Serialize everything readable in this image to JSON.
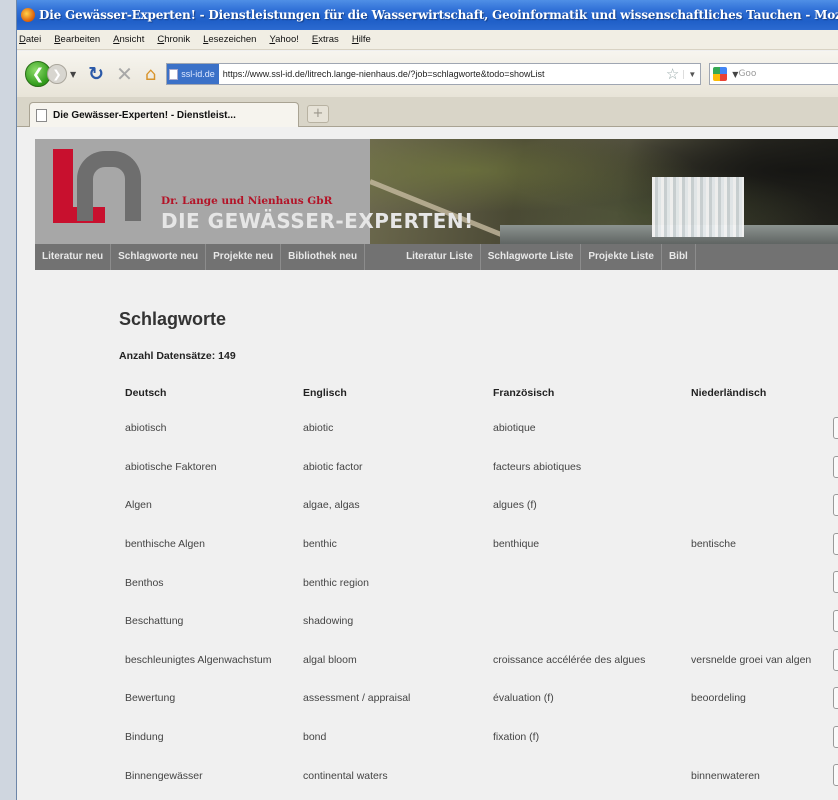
{
  "window": {
    "title": "Die Gewässer-Experten! - Dienstleistungen für die Wasserwirtschaft, Geoinformatik und wissenschaftliches Tauchen - Moz"
  },
  "menu": [
    "Datei",
    "Bearbeiten",
    "Ansicht",
    "Chronik",
    "Lesezeichen",
    "Yahoo!",
    "Extras",
    "Hilfe"
  ],
  "toolbar": {
    "site_badge": "ssl-id.de",
    "url": "https://www.ssl-id.de/litrech.lange-nienhaus.de/?job=schlagworte&todo=showList",
    "search_placeholder": "Goo"
  },
  "tab": {
    "label": "Die Gewässer-Experten! - Dienstleist...",
    "new_tab": "+"
  },
  "site": {
    "firm": "Dr. Lange und Nienhaus GbR",
    "slogan": "DIE GEWÄSSER-EXPERTEN!",
    "nav_left": [
      "Literatur neu",
      "Schlagworte neu",
      "Projekte neu",
      "Bibliothek neu"
    ],
    "nav_right": [
      "Literatur Liste",
      "Schlagworte Liste",
      "Projekte Liste",
      "Bibl"
    ]
  },
  "page": {
    "title": "Schlagworte",
    "count": "Anzahl Datensätze: 149"
  },
  "table": {
    "headers": [
      "Deutsch",
      "Englisch",
      "Französisch",
      "Niederländisch"
    ],
    "rows": [
      [
        "abiotisch",
        "abiotic",
        "abiotique",
        ""
      ],
      [
        "abiotische Faktoren",
        "abiotic factor",
        "facteurs abiotiques",
        ""
      ],
      [
        "Algen",
        "algae, algas",
        "algues (f)",
        ""
      ],
      [
        "benthische Algen",
        "benthic",
        "benthique",
        "bentische"
      ],
      [
        "Benthos",
        "benthic region",
        "",
        ""
      ],
      [
        "Beschattung",
        "shadowing",
        "",
        ""
      ],
      [
        "beschleunigtes Algenwachstum",
        "algal bloom",
        "croissance accélérée des algues",
        "versnelde groei van algen"
      ],
      [
        "Bewertung",
        "assessment / appraisal",
        "évaluation (f)",
        "beoordeling"
      ],
      [
        "Bindung",
        "bond",
        "fixation (f)",
        ""
      ],
      [
        "Binnengewässer",
        "continental waters",
        "",
        "binnenwateren"
      ]
    ]
  }
}
